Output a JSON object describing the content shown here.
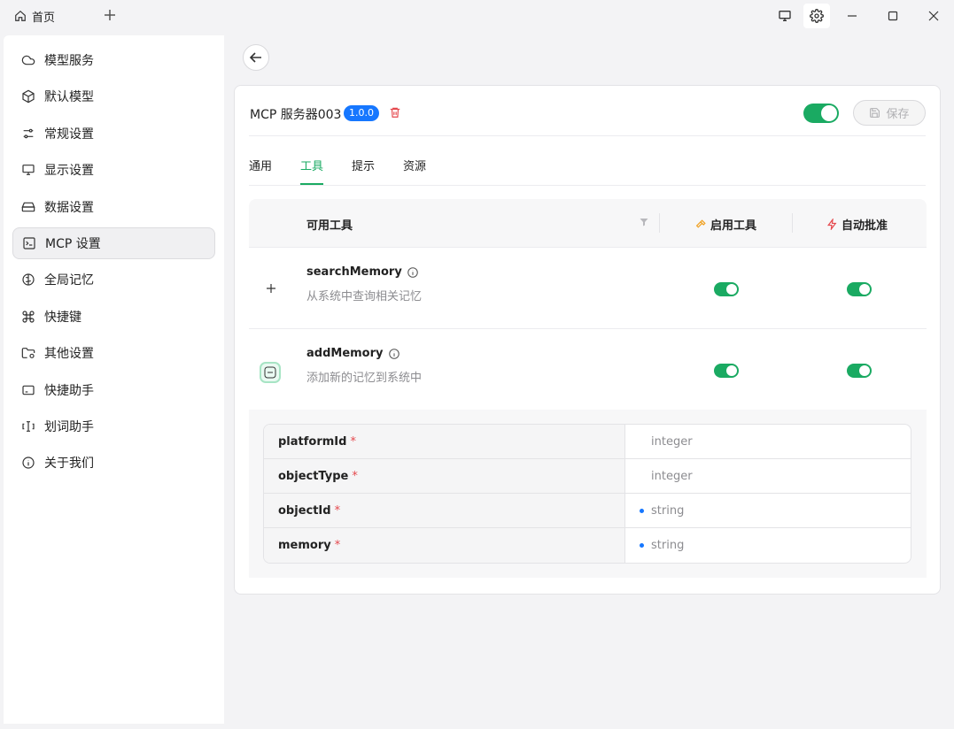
{
  "titlebar": {
    "home_tab_label": "首页"
  },
  "sidebar": {
    "items": [
      {
        "label": "模型服务",
        "icon": "cloud-icon"
      },
      {
        "label": "默认模型",
        "icon": "cube-icon"
      },
      {
        "label": "常规设置",
        "icon": "sliders-icon"
      },
      {
        "label": "显示设置",
        "icon": "monitor-icon"
      },
      {
        "label": "数据设置",
        "icon": "hard-drive-icon"
      },
      {
        "label": "MCP 设置",
        "icon": "terminal-icon",
        "active": true
      },
      {
        "label": "全局记忆",
        "icon": "brain-icon"
      },
      {
        "label": "快捷键",
        "icon": "command-icon"
      },
      {
        "label": "其他设置",
        "icon": "folder-cog-icon"
      },
      {
        "label": "快捷助手",
        "icon": "window-icon"
      },
      {
        "label": "划词助手",
        "icon": "text-cursor-icon"
      },
      {
        "label": "关于我们",
        "icon": "info-icon"
      }
    ]
  },
  "server": {
    "name": "MCP 服务器003",
    "version": "1.0.0",
    "enabled": true,
    "save_label": "保存"
  },
  "tabs": [
    {
      "label": "通用"
    },
    {
      "label": "工具",
      "active": true
    },
    {
      "label": "提示"
    },
    {
      "label": "资源"
    }
  ],
  "tools_table": {
    "header_name": "可用工具",
    "header_enable": "启用工具",
    "header_auto": "自动批准",
    "tools": [
      {
        "name": "searchMemory",
        "description": "从系统中查询相关记忆",
        "enabled": true,
        "auto_approve": true,
        "expanded": false
      },
      {
        "name": "addMemory",
        "description": "添加新的记忆到系统中",
        "enabled": true,
        "auto_approve": true,
        "expanded": true
      }
    ],
    "params": [
      {
        "name": "platformId",
        "required_mark": "*",
        "type": "integer",
        "dot": false
      },
      {
        "name": "objectType",
        "required_mark": "*",
        "type": "integer",
        "dot": false
      },
      {
        "name": "objectId",
        "required_mark": "*",
        "type": "string",
        "dot": true
      },
      {
        "name": "memory",
        "required_mark": "*",
        "type": "string",
        "dot": true
      }
    ]
  },
  "colors": {
    "accent_green": "#1aaa62",
    "badge_blue": "#1677ff",
    "required_red": "#e5484d",
    "enable_icon_orange": "#f0a020",
    "auto_icon_red": "#e5484d"
  }
}
